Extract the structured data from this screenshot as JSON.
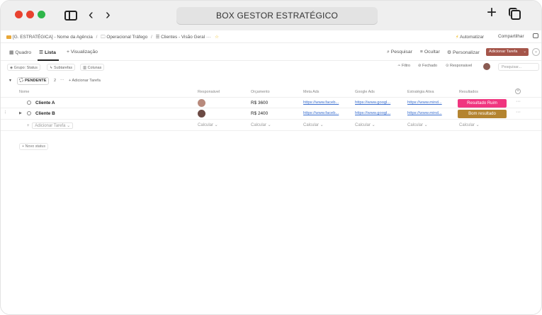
{
  "window": {
    "title": "BOX GESTOR ESTRATÉGICO",
    "accent_colors": {
      "close": "#e8422f",
      "minimize": "#e8422f",
      "zoom": "#2fb64a"
    }
  },
  "breadcrumb": {
    "space": "[G. ESTRATÉGICA] - Nome da Agência",
    "folder": "Operacional Tráfego",
    "list": "Clientes - Visão Geral",
    "more": "···"
  },
  "top_actions": {
    "automate": "Automatizar",
    "share": "Compartilhar"
  },
  "view_tabs": {
    "board": "Quadro",
    "list": "Lista",
    "add_view": "+ Visualização",
    "search": "Pesquisar",
    "hide": "Ocultar",
    "customize": "Personalizar",
    "add_task": "Adicionar Tarefa"
  },
  "filters": {
    "group": "Grupo: Status",
    "subtasks": "Subtarefas",
    "columns": "Colunas",
    "filter": "Filtro",
    "closed": "Fechado",
    "assignee": "Responsável",
    "search_placeholder": "Pesquisar..."
  },
  "status_group": {
    "name": "PENDENTE",
    "count": "2",
    "more": "···",
    "add_task": "+ Adicionar Tarefa"
  },
  "table": {
    "columns": [
      "Nome",
      "Responsável",
      "Orçamento",
      "Meta Ads",
      "Google Ads",
      "Estratégia Ativa",
      "Resultados"
    ],
    "rows": [
      {
        "name": "Cliente A",
        "budget": "R$ 3600",
        "meta_ads": "https://www.faceb...",
        "google_ads": "https://www.googl...",
        "strategy": "https://www.mind...",
        "result": "Resultado Ruim",
        "result_color": "#f0357f"
      },
      {
        "name": "Cliente B",
        "budget": "R$ 2400",
        "meta_ads": "https://www.faceb...",
        "google_ads": "https://www.googl...",
        "strategy": "https://www.mind...",
        "result": "Bom resultado",
        "result_color": "#b48430"
      }
    ],
    "add_task_label": "Adicionar Tarefa",
    "calc_label": "Calcular ⌄"
  },
  "new_status": "+ Novo status"
}
